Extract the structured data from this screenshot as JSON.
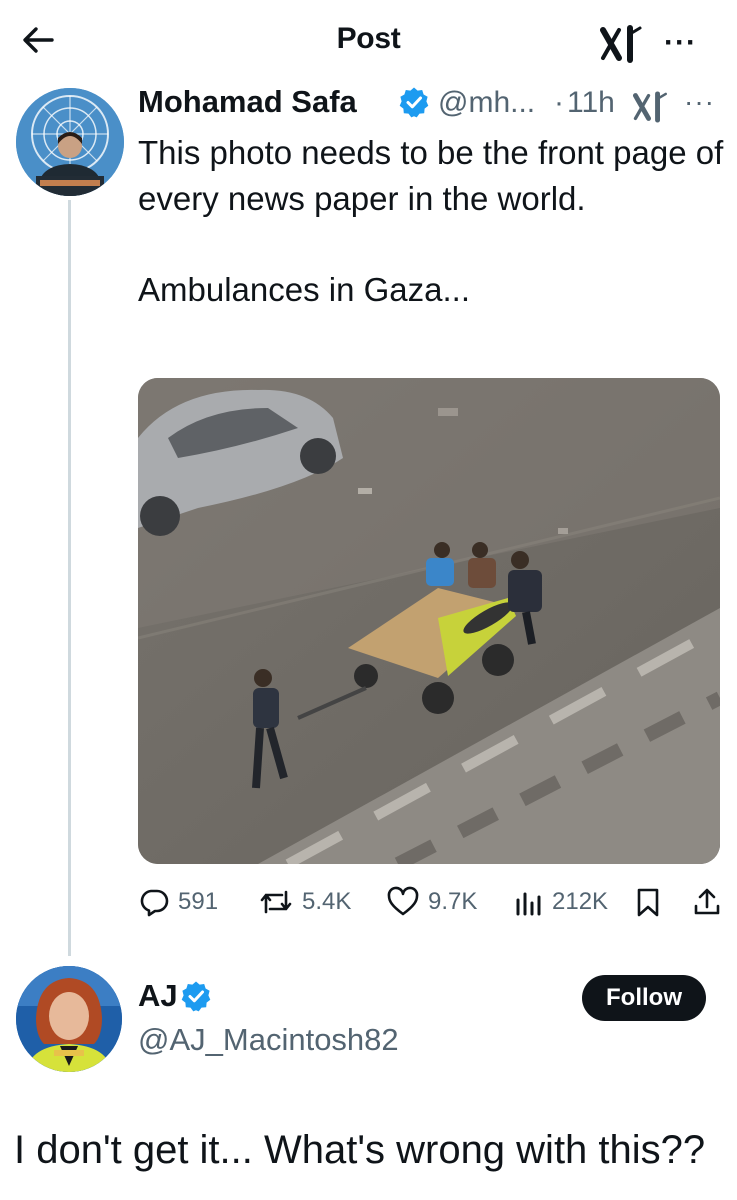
{
  "header": {
    "title": "Post",
    "back_icon": "arrow-left-icon",
    "grok_icon": "grok-icon",
    "more_icon": "more-icon"
  },
  "tweet": {
    "author_name": "Mohamad Safa",
    "handle": "@mh...",
    "separator": "·",
    "time": "11h",
    "text": "This photo needs to be the front page of every news paper in the world.\n\nAmbulances in Gaza...",
    "media_icon": "photo",
    "metrics": {
      "replies": "591",
      "reposts": "5.4K",
      "likes": "9.7K",
      "views": "212K"
    }
  },
  "reply": {
    "author_name": "AJ",
    "handle": "@AJ_Macintosh82",
    "follow_label": "Follow",
    "text": "I don't get it... What's wrong with this??"
  },
  "colors": {
    "text": "#0f1419",
    "secondary": "#536471",
    "verified": "#1d9bf0",
    "thread_line": "#cfd9de",
    "follow_bg": "#0f1419"
  }
}
